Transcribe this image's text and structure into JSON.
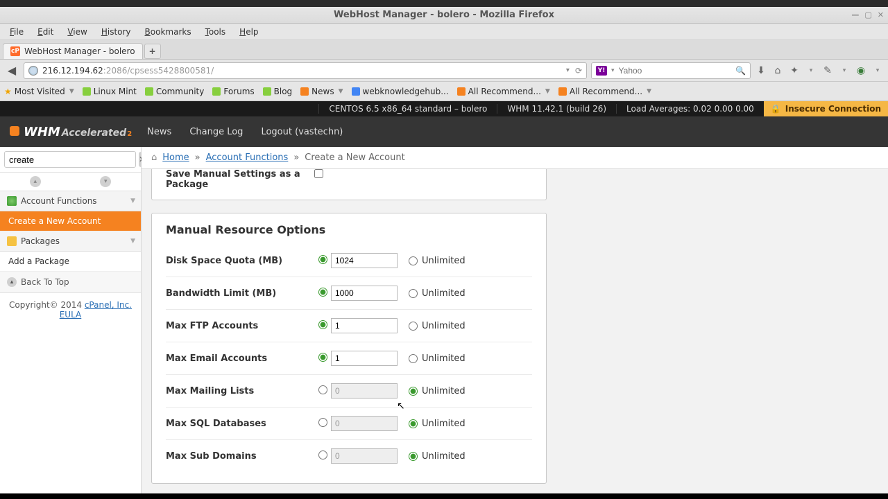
{
  "window_title": "WebHost Manager - bolero - Mozilla Firefox",
  "menu": [
    "File",
    "Edit",
    "View",
    "History",
    "Bookmarks",
    "Tools",
    "Help"
  ],
  "tab": {
    "title": "WebHost Manager - bolero"
  },
  "url": {
    "host": "216.12.194.62",
    "path": ":2086/cpsess5428800581/"
  },
  "search": {
    "placeholder": "Yahoo",
    "engine": "Y!"
  },
  "bookmarks": [
    {
      "label": "Most Visited",
      "dd": true,
      "icon": "star"
    },
    {
      "label": "Linux Mint",
      "icon": "mint"
    },
    {
      "label": "Community",
      "icon": "mint"
    },
    {
      "label": "Forums",
      "icon": "mint"
    },
    {
      "label": "Blog",
      "icon": "mint"
    },
    {
      "label": "News",
      "dd": true,
      "icon": "rss"
    },
    {
      "label": "webknowledgehub...",
      "icon": "g"
    },
    {
      "label": "All Recommend...",
      "dd": true,
      "icon": "rss"
    },
    {
      "label": "All Recommend...",
      "dd": true,
      "icon": "rss"
    }
  ],
  "blackbar": {
    "os": "CENTOS 6.5 x86_64 standard – bolero",
    "whm": "WHM 11.42.1 (build 26)",
    "load": "Load Averages: 0.02 0.00 0.00",
    "insecure": "Insecure Connection"
  },
  "nav": {
    "logo1": "WHM",
    "logo2": "Accelerated",
    "links": [
      "News",
      "Change Log",
      "Logout (vastechn)"
    ]
  },
  "sidebar": {
    "search": "create",
    "groups": [
      {
        "label": "Account Functions",
        "icon": "af",
        "items": [
          {
            "label": "Create a New Account",
            "active": true
          }
        ]
      },
      {
        "label": "Packages",
        "icon": "pk",
        "items": [
          {
            "label": "Add a Package"
          }
        ]
      }
    ],
    "backtop": "Back To Top",
    "copyright_pre": "Copyright© 2014 ",
    "copyright_link1": "cPanel, Inc.",
    "copyright_link2": "EULA"
  },
  "breadcrumb": {
    "home": "Home",
    "group": "Account Functions",
    "page": "Create a New Account"
  },
  "save_panel": {
    "label": "Save Manual Settings as a Package",
    "checked": false
  },
  "resource_panel": {
    "title": "Manual Resource Options",
    "rows": [
      {
        "label": "Disk Space Quota (MB)",
        "value": "1024",
        "mode": "value"
      },
      {
        "label": "Bandwidth Limit (MB)",
        "value": "1000",
        "mode": "value"
      },
      {
        "label": "Max FTP Accounts",
        "value": "1",
        "mode": "value"
      },
      {
        "label": "Max Email Accounts",
        "value": "1",
        "mode": "value"
      },
      {
        "label": "Max Mailing Lists",
        "value": "0",
        "mode": "unlimited"
      },
      {
        "label": "Max SQL Databases",
        "value": "0",
        "mode": "unlimited"
      },
      {
        "label": "Max Sub Domains",
        "value": "0",
        "mode": "unlimited"
      }
    ],
    "unlimited_label": "Unlimited"
  }
}
